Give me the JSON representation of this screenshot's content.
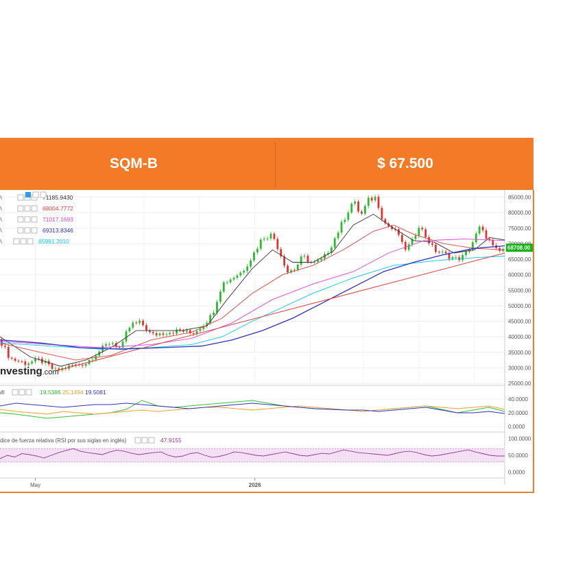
{
  "header": {
    "ticker": "SQM-B",
    "price": "$ 67.500",
    "accent": "#f37b27"
  },
  "watermark": {
    "name": "nvesting",
    "suffix": ".com"
  },
  "chart_data": [
    {
      "type": "candlestick",
      "panel": "price",
      "ylim": [
        25000,
        86000
      ],
      "yticks": [
        "85000.00",
        "80000.00",
        "75000.00",
        "70000.00",
        "65000.00",
        "60000.00",
        "55000.00",
        "50000.00",
        "45000.00",
        "40000.00",
        "35000.00",
        "30000.00",
        "25000.00"
      ],
      "ytick_values": [
        85000,
        80000,
        75000,
        70000,
        65000,
        60000,
        55000,
        50000,
        45000,
        40000,
        35000,
        30000,
        25000
      ],
      "xticks": [
        "May",
        "2026"
      ],
      "xtick_pos": [
        0.07,
        0.505
      ],
      "grid": true,
      "last_price": "68708.00",
      "last_value": 68708,
      "close_path": [
        [
          0,
          39000
        ],
        [
          0.02,
          33000
        ],
        [
          0.05,
          31500
        ],
        [
          0.08,
          32500
        ],
        [
          0.11,
          29000
        ],
        [
          0.14,
          30500
        ],
        [
          0.17,
          31500
        ],
        [
          0.19,
          34500
        ],
        [
          0.22,
          38500
        ],
        [
          0.24,
          36000
        ],
        [
          0.25,
          41000
        ],
        [
          0.26,
          44000
        ],
        [
          0.28,
          44500
        ],
        [
          0.3,
          40500
        ],
        [
          0.33,
          41500
        ],
        [
          0.36,
          42000
        ],
        [
          0.38,
          41000
        ],
        [
          0.4,
          43500
        ],
        [
          0.42,
          47000
        ],
        [
          0.44,
          57000
        ],
        [
          0.46,
          59000
        ],
        [
          0.48,
          61000
        ],
        [
          0.5,
          66000
        ],
        [
          0.52,
          72000
        ],
        [
          0.54,
          73000
        ],
        [
          0.555,
          67000
        ],
        [
          0.57,
          61000
        ],
        [
          0.585,
          62000
        ],
        [
          0.6,
          66000
        ],
        [
          0.62,
          63500
        ],
        [
          0.64,
          65000
        ],
        [
          0.655,
          69000
        ],
        [
          0.67,
          74000
        ],
        [
          0.685,
          79000
        ],
        [
          0.7,
          84000
        ],
        [
          0.715,
          79000
        ],
        [
          0.73,
          84000
        ],
        [
          0.745,
          85000
        ],
        [
          0.76,
          77000
        ],
        [
          0.775,
          75000
        ],
        [
          0.79,
          73000
        ],
        [
          0.8,
          68000
        ],
        [
          0.815,
          70000
        ],
        [
          0.83,
          76000
        ],
        [
          0.845,
          72000
        ],
        [
          0.86,
          68000
        ],
        [
          0.875,
          67000
        ],
        [
          0.89,
          66000
        ],
        [
          0.905,
          65000
        ],
        [
          0.92,
          66000
        ],
        [
          0.935,
          70000
        ],
        [
          0.95,
          75000
        ],
        [
          0.965,
          72000
        ],
        [
          0.98,
          68000
        ],
        [
          0.99,
          67500
        ],
        [
          1,
          68708
        ]
      ],
      "moving_averages": [
        {
          "value": "71185.9430",
          "color": "#333333"
        },
        {
          "value": "68004.7772",
          "color": "#e0403a"
        },
        {
          "value": "71017.1693",
          "color": "#e040e0"
        },
        {
          "value": "69313.8346",
          "color": "#3030c0"
        },
        {
          "value": "65991.2010",
          "color": "#00c8e8"
        }
      ],
      "ma_lines": [
        {
          "color": "#333333",
          "points": [
            [
              0,
              40000
            ],
            [
              0.06,
              33500
            ],
            [
              0.12,
              30500
            ],
            [
              0.17,
              32500
            ],
            [
              0.22,
              36500
            ],
            [
              0.27,
              42000
            ],
            [
              0.31,
              42000
            ],
            [
              0.36,
              42000
            ],
            [
              0.41,
              43500
            ],
            [
              0.45,
              52000
            ],
            [
              0.5,
              62000
            ],
            [
              0.54,
              68000
            ],
            [
              0.58,
              64000
            ],
            [
              0.62,
              64000
            ],
            [
              0.66,
              67500
            ],
            [
              0.7,
              76000
            ],
            [
              0.74,
              79500
            ],
            [
              0.78,
              75000
            ],
            [
              0.82,
              71000
            ],
            [
              0.86,
              70500
            ],
            [
              0.9,
              67000
            ],
            [
              0.94,
              68000
            ],
            [
              0.97,
              72000
            ],
            [
              1,
              71186
            ]
          ]
        },
        {
          "color": "#e0403a",
          "points": [
            [
              0,
              38000
            ],
            [
              0.08,
              35000
            ],
            [
              0.15,
              32500
            ],
            [
              0.22,
              34000
            ],
            [
              0.3,
              39000
            ],
            [
              0.38,
              41500
            ],
            [
              0.44,
              46000
            ],
            [
              0.5,
              54000
            ],
            [
              0.56,
              60000
            ],
            [
              0.62,
              63000
            ],
            [
              0.68,
              68000
            ],
            [
              0.74,
              74000
            ],
            [
              0.78,
              76000
            ],
            [
              0.82,
              73000
            ],
            [
              0.88,
              70000
            ],
            [
              0.94,
              68500
            ],
            [
              1,
              68005
            ]
          ]
        },
        {
          "color": "#e040e0",
          "points": [
            [
              0,
              38500
            ],
            [
              0.1,
              37500
            ],
            [
              0.2,
              36500
            ],
            [
              0.3,
              37500
            ],
            [
              0.38,
              39500
            ],
            [
              0.46,
              44500
            ],
            [
              0.54,
              52000
            ],
            [
              0.62,
              57000
            ],
            [
              0.7,
              61000
            ],
            [
              0.77,
              67000
            ],
            [
              0.84,
              71000
            ],
            [
              0.92,
              71500
            ],
            [
              1,
              71017
            ]
          ]
        },
        {
          "color": "#00c8e8",
          "points": [
            [
              0,
              38000
            ],
            [
              0.1,
              37000
            ],
            [
              0.2,
              36000
            ],
            [
              0.3,
              36500
            ],
            [
              0.38,
              37500
            ],
            [
              0.44,
              40000
            ],
            [
              0.5,
              45000
            ],
            [
              0.56,
              49500
            ],
            [
              0.62,
              54000
            ],
            [
              0.7,
              59000
            ],
            [
              0.78,
              63000
            ],
            [
              0.86,
              64500
            ],
            [
              0.94,
              65500
            ],
            [
              1,
              65991
            ]
          ]
        },
        {
          "color": "#3030c0",
          "points": [
            [
              0,
              39000
            ],
            [
              0.08,
              38000
            ],
            [
              0.16,
              36500
            ],
            [
              0.24,
              36000
            ],
            [
              0.32,
              36500
            ],
            [
              0.4,
              37000
            ],
            [
              0.46,
              39000
            ],
            [
              0.52,
              42000
            ],
            [
              0.58,
              46000
            ],
            [
              0.64,
              51000
            ],
            [
              0.7,
              56000
            ],
            [
              0.76,
              61000
            ],
            [
              0.82,
              64000
            ],
            [
              0.88,
              66500
            ],
            [
              0.94,
              68500
            ],
            [
              1,
              69314
            ]
          ]
        }
      ],
      "trendline": [
        [
          0.11,
          29000
        ],
        [
          1,
          67000
        ]
      ]
    },
    {
      "type": "line",
      "panel": "indicator",
      "label": "MI",
      "values_text": [
        "19.5386",
        "25.1494",
        "19.5081"
      ],
      "colors": [
        "#30c030",
        "#f0a030",
        "#3030c0"
      ],
      "ylim": [
        -5,
        55
      ],
      "yticks": [
        "40.0000",
        "20.0000",
        "0.0000"
      ],
      "ytick_values": [
        40,
        20,
        0
      ],
      "series": [
        {
          "values": [
            20,
            18,
            15,
            12,
            14,
            16,
            18,
            20,
            25,
            38,
            30,
            28,
            30,
            32,
            34,
            36,
            38,
            34,
            30,
            28,
            26,
            25,
            24,
            22,
            24,
            26,
            28,
            30,
            25,
            20,
            24,
            28,
            22
          ]
        },
        {
          "values": [
            25,
            22,
            20,
            18,
            22,
            20,
            18,
            20,
            22,
            24,
            22,
            24,
            26,
            28,
            28,
            26,
            24,
            26,
            28,
            30,
            28,
            26,
            24,
            22,
            24,
            26,
            28,
            30,
            28,
            26,
            28,
            30,
            25
          ]
        },
        {
          "values": [
            30,
            34,
            32,
            30,
            28,
            30,
            32,
            32,
            34,
            32,
            30,
            28,
            26,
            28,
            30,
            32,
            34,
            32,
            30,
            28,
            26,
            25,
            24,
            24,
            22,
            24,
            26,
            28,
            24,
            20,
            20,
            22,
            19
          ]
        }
      ]
    },
    {
      "type": "line",
      "panel": "rsi",
      "label": "dice de fuerza relativa (RSI por sus siglas en inglés)",
      "value": "47.9155",
      "color": "#9c2fa0",
      "ylim": [
        -5,
        105
      ],
      "yticks": [
        "100.0000",
        "50.0000",
        "0.0000"
      ],
      "ytick_values": [
        100,
        50,
        0
      ],
      "band": [
        30,
        70
      ],
      "series": [
        {
          "values": [
            40,
            50,
            45,
            55,
            52,
            48,
            42,
            50,
            58,
            64,
            70,
            62,
            58,
            55,
            52,
            60,
            65,
            62,
            56,
            52,
            55,
            58,
            60,
            50,
            45,
            48,
            55,
            58,
            50,
            44,
            47,
            52,
            60,
            58,
            54,
            50,
            48,
            52,
            56,
            60,
            55,
            50,
            48,
            52,
            56,
            54,
            60,
            66,
            62,
            58,
            56,
            54,
            52,
            50,
            55,
            60,
            62,
            58,
            52,
            48,
            50,
            54,
            58,
            62,
            66,
            60,
            55,
            50,
            48,
            47.9
          ]
        }
      ]
    }
  ]
}
